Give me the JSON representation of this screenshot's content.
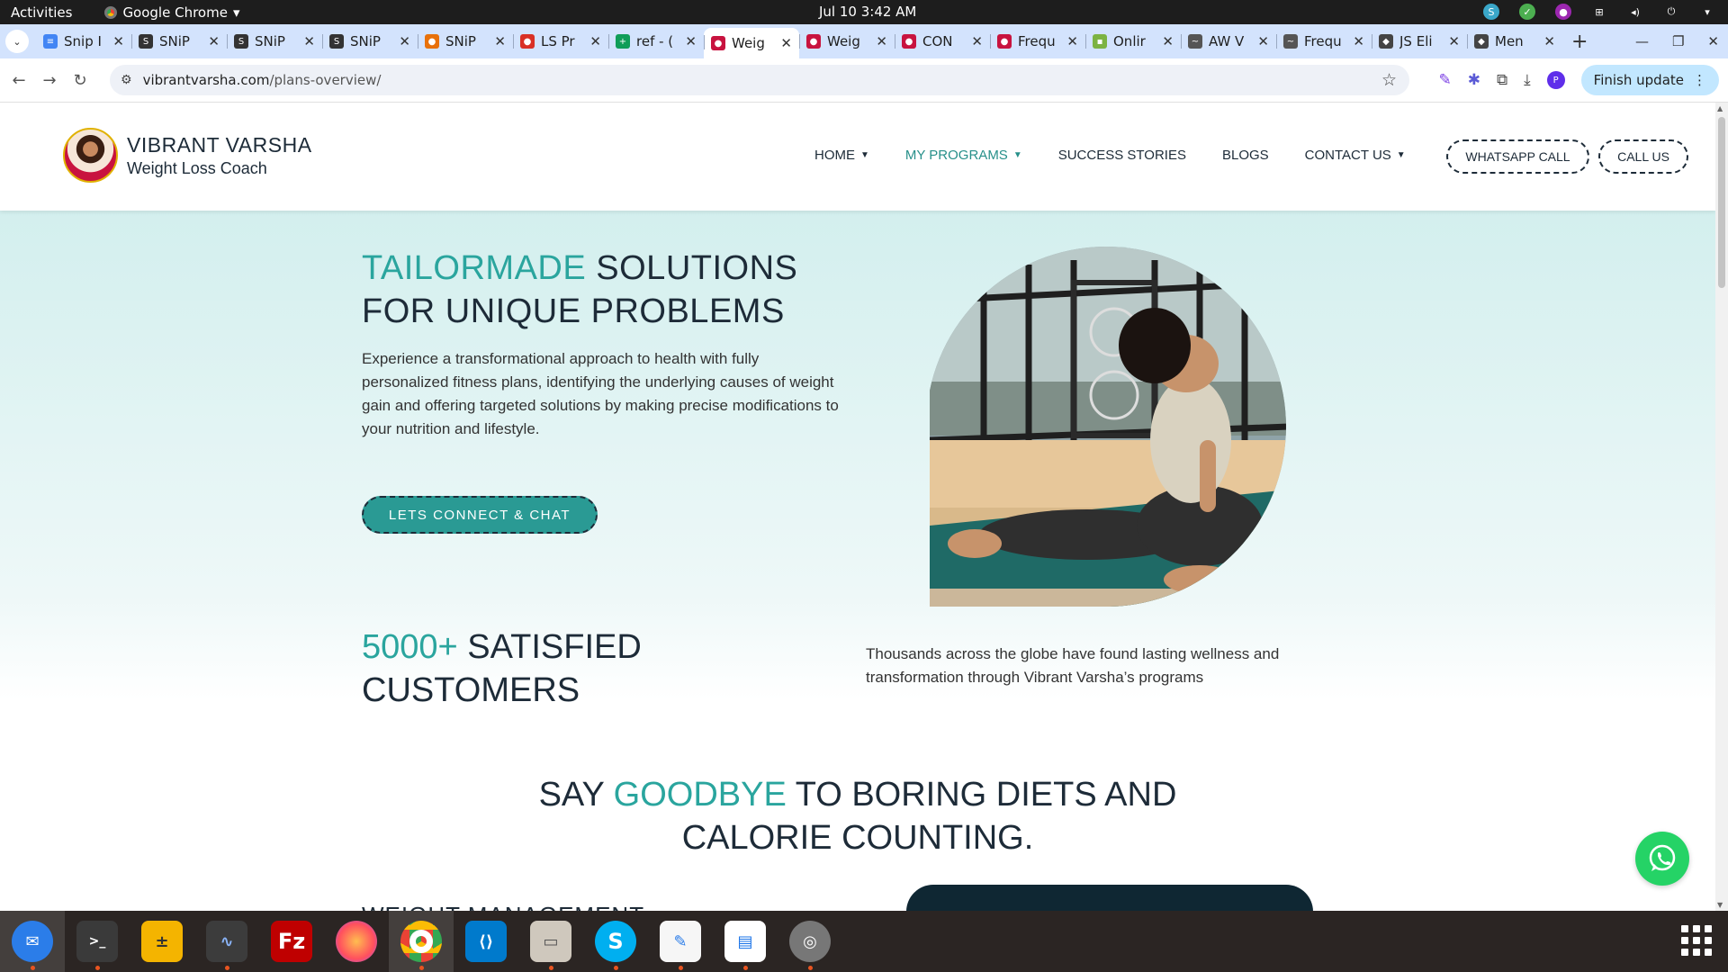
{
  "system": {
    "activities": "Activities",
    "app_menu": "Google Chrome",
    "clock": "Jul 10  3:42 AM"
  },
  "tabs": [
    {
      "title": "Snip I",
      "fav_color": "#4285f4",
      "fav": "≡"
    },
    {
      "title": "SNiP",
      "fav_color": "#333333",
      "fav": "S"
    },
    {
      "title": "SNiP",
      "fav_color": "#333333",
      "fav": "S"
    },
    {
      "title": "SNiP",
      "fav_color": "#333333",
      "fav": "S"
    },
    {
      "title": "SNiP",
      "fav_color": "#e8710a",
      "fav": "●"
    },
    {
      "title": "LS Pr",
      "fav_color": "#d93025",
      "fav": "●"
    },
    {
      "title": "ref - (",
      "fav_color": "#0f9d58",
      "fav": "+"
    },
    {
      "title": "Weig",
      "fav_color": "#c8133f",
      "fav": "●",
      "active": true
    },
    {
      "title": "Weig",
      "fav_color": "#c8133f",
      "fav": "●"
    },
    {
      "title": "CON",
      "fav_color": "#c8133f",
      "fav": "●"
    },
    {
      "title": "Frequ",
      "fav_color": "#c8133f",
      "fav": "●"
    },
    {
      "title": "Onlir",
      "fav_color": "#7cb342",
      "fav": "▪"
    },
    {
      "title": "AW V",
      "fav_color": "#555555",
      "fav": "~"
    },
    {
      "title": "Frequ",
      "fav_color": "#555555",
      "fav": "~"
    },
    {
      "title": "JS Eli",
      "fav_color": "#444444",
      "fav": "◆"
    },
    {
      "title": "Men",
      "fav_color": "#444444",
      "fav": "◆"
    }
  ],
  "browser": {
    "url_host": "vibrantvarsha.com",
    "url_path": "/plans-overview/",
    "finish_update": "Finish update",
    "profile_initial": "P"
  },
  "site": {
    "brand_name": "VIBRANT VARSHA",
    "brand_sub": "Weight Loss Coach",
    "menu": {
      "home": "HOME",
      "programs": "MY PROGRAMS",
      "stories": "SUCCESS STORIES",
      "blogs": "BLOGS",
      "contact": "CONTACT US"
    },
    "whatsapp_call": "WHATSAPP CALL",
    "call_us": "CALL US",
    "accent_color": "#2aa59e"
  },
  "hero": {
    "title_accent": "TAILORMADE",
    "title_rest_1": " SOLUTIONS",
    "title_rest_2": "FOR UNIQUE PROBLEMS",
    "description": "Experience a transformational approach to health with fully personalized fitness plans, identifying the underlying causes of weight gain and offering targeted solutions by making precise modifications to your nutrition and lifestyle.",
    "cta": "LETS CONNECT & CHAT"
  },
  "stats": {
    "number": "5000+",
    "title_1": " SATISFIED",
    "title_2": "CUSTOMERS",
    "description": "Thousands across the globe have found lasting wellness and transformation through Vibrant Varsha’s programs"
  },
  "goodbye": {
    "pre": "SAY ",
    "accent": "GOODBYE",
    "post": " TO BORING DIETS AND",
    "line2": "CALORIE COUNTING."
  },
  "next_section": {
    "heading": "WEIGHT MANAGEMENT"
  }
}
